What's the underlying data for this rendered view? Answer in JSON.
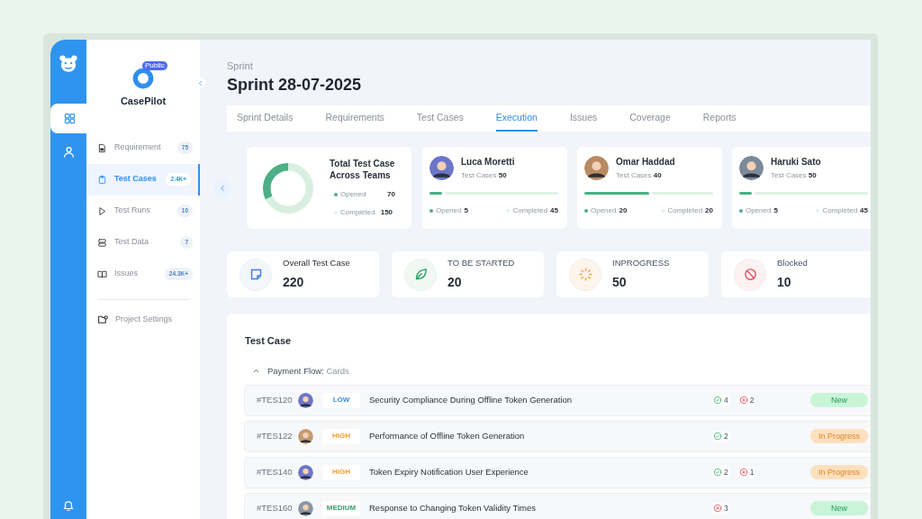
{
  "rail": [
    {
      "kind": "grid",
      "selected": true
    },
    {
      "kind": "user",
      "selected": false
    }
  ],
  "sidebar": {
    "project": "CasePilot",
    "visibility_badge": "Public",
    "items": [
      {
        "kind": "doc",
        "label": "Requirement",
        "count": "75",
        "selected": false
      },
      {
        "kind": "clipboard",
        "label": "Test Cases",
        "count": "2.4K+",
        "selected": true
      },
      {
        "kind": "play",
        "label": "Test Runs",
        "count": "10",
        "selected": false
      },
      {
        "kind": "data",
        "label": "Test Data",
        "count": "7",
        "selected": false
      },
      {
        "kind": "book",
        "label": "Issues",
        "count": "24.3K+",
        "selected": false
      }
    ],
    "settings": "Project Settings"
  },
  "breadcrumb": "Sprint",
  "title": "Sprint 28-07-2025",
  "tabs": [
    {
      "label": "Sprint Details",
      "selected": false
    },
    {
      "label": "Requirements",
      "selected": false
    },
    {
      "label": "Test Cases",
      "selected": false
    },
    {
      "label": "Execution",
      "selected": true
    },
    {
      "label": "Issues",
      "selected": false
    },
    {
      "label": "Coverage",
      "selected": false
    },
    {
      "label": "Reports",
      "selected": false
    }
  ],
  "total": {
    "title": "Total Test Case Across Teams",
    "level": 0.32,
    "opened_label": "Opened",
    "opened": "70",
    "completed_label": "Completed",
    "completed": "150"
  },
  "members": [
    {
      "name": "Luca Moretti",
      "cases_label": "Test Cases",
      "cases": "50",
      "level": 0.1,
      "opened_label": "Opened",
      "opened": "5",
      "completed_label": "Completed",
      "completed": "45"
    },
    {
      "name": "Omar Haddad",
      "cases_label": "Test Cases",
      "cases": "40",
      "level": 0.5,
      "opened_label": "Opened",
      "opened": "20",
      "completed_label": "Completed",
      "completed": "20"
    },
    {
      "name": "Haruki Sato",
      "cases_label": "Test Cases",
      "cases": "50",
      "level": 0.1,
      "opened_label": "Opened",
      "opened": "5",
      "completed_label": "Completed",
      "completed": "45"
    }
  ],
  "stats": [
    {
      "kind": "overall",
      "label": "Overall Test Case",
      "value": "220"
    },
    {
      "kind": "not_started",
      "label": "TO BE STARTED",
      "value": "20"
    },
    {
      "kind": "in_progress",
      "label": "INPROGRESS",
      "value": "50"
    },
    {
      "kind": "blocked",
      "label": "Blocked",
      "value": "10"
    }
  ],
  "test_case": {
    "title": "Test Case",
    "group_label": "Payment Flow:",
    "group_name": "Cards",
    "expanded": true,
    "rows": [
      {
        "id": "#TES120",
        "priority": {
          "kind": "low",
          "label": "LOW"
        },
        "title": "Security Compliance During Offline Token Generation",
        "passed": "4",
        "failed": "2",
        "status": {
          "kind": "new",
          "label": "New"
        }
      },
      {
        "id": "#TES122",
        "priority": {
          "kind": "high",
          "label": "HIGH"
        },
        "title": "Performance of Offline Token Generation",
        "passed": "2",
        "status": {
          "kind": "in_progress",
          "label": "In Progress"
        }
      },
      {
        "id": "#TES140",
        "priority": {
          "kind": "high",
          "label": "HIGH"
        },
        "title": "Token Expiry Notification User Experience",
        "passed": "2",
        "failed": "1",
        "status": {
          "kind": "in_progress",
          "label": "In Progress"
        }
      },
      {
        "id": "#TES160",
        "priority": {
          "kind": "medium",
          "label": "MEDIUM"
        },
        "title": "Response to Changing Token Validity Times",
        "failed": "3",
        "status": {
          "kind": "new",
          "label": "New"
        }
      }
    ]
  }
}
